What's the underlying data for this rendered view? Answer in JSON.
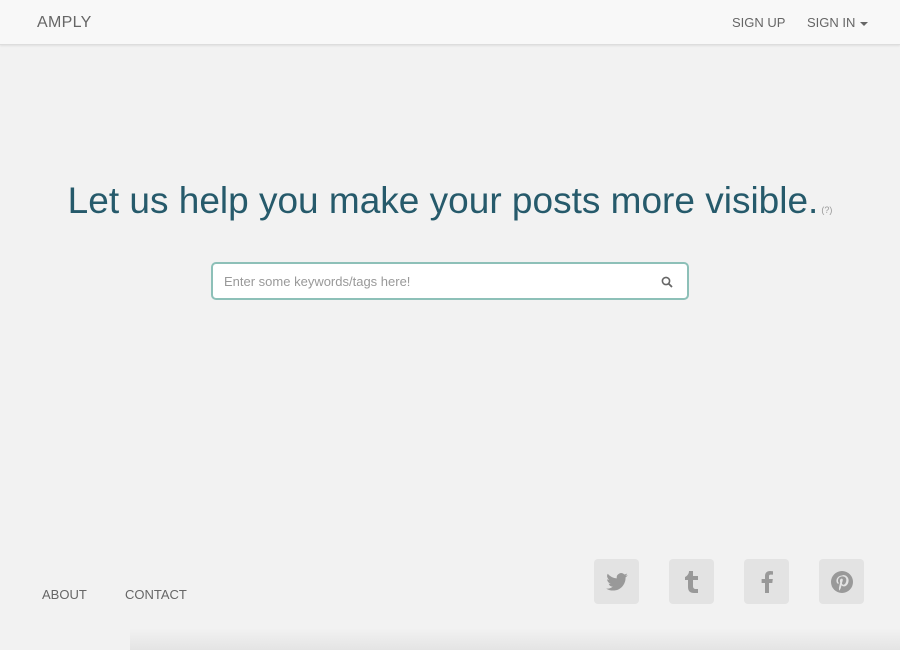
{
  "nav": {
    "brand": "AMPLY",
    "sign_up": "SIGN UP",
    "sign_in": "SIGN IN"
  },
  "hero": {
    "headline": "Let us help you make your posts more visible.",
    "help": "(?)"
  },
  "search": {
    "placeholder": "Enter some keywords/tags here!",
    "value": ""
  },
  "footer": {
    "about": "ABOUT",
    "contact": "CONTACT",
    "social": [
      "twitter",
      "tumblr",
      "facebook",
      "pinterest"
    ]
  }
}
